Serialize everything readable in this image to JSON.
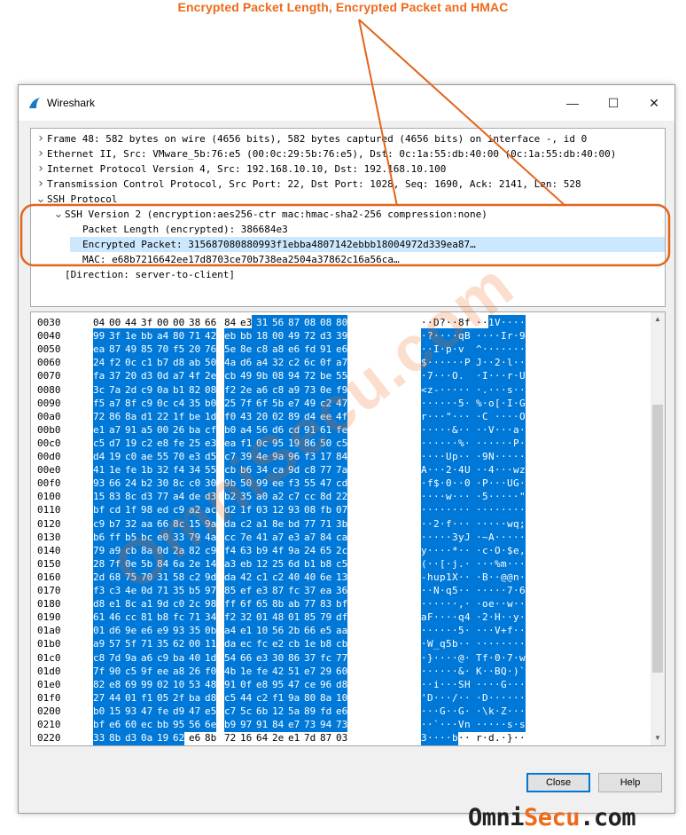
{
  "annotation": {
    "title": "Encrypted Packet Length, Encrypted Packet and HMAC"
  },
  "window": {
    "title": "Wireshark",
    "minimize_glyph": "—",
    "maximize_glyph": "☐",
    "close_glyph": "✕"
  },
  "tree": [
    {
      "text": "Frame 48: 582 bytes on wire (4656 bits), 582 bytes captured (4656 bits) on interface -, id 0",
      "expander": ">"
    },
    {
      "text": "Ethernet II, Src: VMware_5b:76:e5 (00:0c:29:5b:76:e5), Dst: 0c:1a:55:db:40:00 (0c:1a:55:db:40:00)",
      "expander": ">"
    },
    {
      "text": "Internet Protocol Version 4, Src: 192.168.10.10, Dst: 192.168.10.100",
      "expander": ">"
    },
    {
      "text": "Transmission Control Protocol, Src Port: 22, Dst Port: 1028, Seq: 1690, Ack: 2141, Len: 528",
      "expander": ">"
    },
    {
      "text": "SSH Protocol",
      "expander": "v"
    },
    {
      "text": "SSH Version 2 (encryption:aes256-ctr mac:hmac-sha2-256 compression:none)",
      "expander": "v"
    },
    {
      "text": "Packet Length (encrypted): 386684e3",
      "expander": ""
    },
    {
      "text": "Encrypted Packet: 315687080880993f1ebba4807142ebbb18004972d339ea87…",
      "expander": ""
    },
    {
      "text": "MAC: e68b7216642ee17d8703ce70b738ea2504a37862c16a56ca…",
      "expander": ""
    },
    {
      "text": "[Direction: server-to-client]",
      "expander": ""
    }
  ],
  "hex_rows": [
    {
      "off": "0030",
      "hex": "04 00 44 3f 00 00 38 66  84 e3 31 56 87 08 08 80",
      "ascii": "··D?··8f ··1V····"
    },
    {
      "off": "0040",
      "hex": "99 3f 1e bb a4 80 71 42  eb bb 18 00 49 72 d3 39",
      "ascii": "·?····qB ····Ir·9"
    },
    {
      "off": "0050",
      "hex": "ea 87 49 85 70 f5 20 76  5e 8e c8 a8 e6 fd 91 e6",
      "ascii": "··I·p· v ^·······"
    },
    {
      "off": "0060",
      "hex": "24 f2 0c c1 b7 d8 ab 50  4a d6 a4 32 c2 6c 0f a7",
      "ascii": "$······P J··2·l··"
    },
    {
      "off": "0070",
      "hex": "fa 37 20 d3 0d a7 4f 2e  cb 49 9b 08 94 72 be 55",
      "ascii": "·7 ···O. ·I···r·U"
    },
    {
      "off": "0080",
      "hex": "3c 7a 2d c9 0a b1 82 08  f2 2e a6 c8 a9 73 0e f9",
      "ascii": "<z-····· ·.···s··"
    },
    {
      "off": "0090",
      "hex": "f5 a7 8f c9 0c c4 35 b0  25 7f 6f 5b e7 49 c2 47",
      "ascii": "······5· %·o[·I·G"
    },
    {
      "off": "00a0",
      "hex": "72 86 8a d1 22 1f be 1d  f0 43 20 02 89 d4 ee 4f",
      "ascii": "r···\"··· ·C ····O"
    },
    {
      "off": "00b0",
      "hex": "e1 a7 91 a5 00 26 ba cf  b0 a4 56 d6 cd 91 61 fe",
      "ascii": "·····&·· ··V···a·"
    },
    {
      "off": "00c0",
      "hex": "c5 d7 19 c2 e8 fe 25 e3  ea f1 0c 95 19 86 50 c5",
      "ascii": "······%· ······P·"
    },
    {
      "off": "00d0",
      "hex": "d4 19 c0 ae 55 70 e3 d5  c7 39 4e 9a 96 f3 17 84",
      "ascii": "····Up·· ·9N·····"
    },
    {
      "off": "00e0",
      "hex": "41 1e fe 1b 32 f4 34 55  cb b6 34 ca 9d c8 77 7a",
      "ascii": "A···2·4U ··4···wz"
    },
    {
      "off": "00f0",
      "hex": "93 66 24 b2 30 8c c0 30  9b 50 99 ee f3 55 47 cd",
      "ascii": "·f$·0··0 ·P···UG·"
    },
    {
      "off": "0100",
      "hex": "15 83 8c d3 77 a4 de d3  b2 35 a0 a2 c7 cc 8d 22",
      "ascii": "····w··· ·5·····\""
    },
    {
      "off": "0110",
      "hex": "bf cd 1f 98 ed c9 a2 ac  d2 1f 03 12 93 08 fb 07",
      "ascii": "········ ········"
    },
    {
      "off": "0120",
      "hex": "c9 b7 32 aa 66 8c 15 9a  da c2 a1 8e bd 77 71 3b",
      "ascii": "··2·f··· ·····wq;"
    },
    {
      "off": "0130",
      "hex": "b6 ff b5 bc e0 33 79 4a  cc 7e 41 a7 e3 a7 84 ca",
      "ascii": "·····3yJ ·~A·····"
    },
    {
      "off": "0140",
      "hex": "79 a9 cb 8a 0d 2a 82 c9  f4 63 b9 4f 9a 24 65 2c",
      "ascii": "y····*·· ·c·O·$e,"
    },
    {
      "off": "0150",
      "hex": "28 7f 0e 5b 84 6a 2e 14  a3 eb 12 25 6d b1 b8 c5",
      "ascii": "(··[·j.· ···%m···"
    },
    {
      "off": "0160",
      "hex": "2d 68 75 70 31 58 c2 9d  da 42 c1 c2 40 40 6e 13",
      "ascii": "-hup1X·· ·B··@@n·"
    },
    {
      "off": "0170",
      "hex": "f3 c3 4e 0d 71 35 b5 97  85 ef e3 87 fc 37 ea 36",
      "ascii": "··N·q5·· ·····7·6"
    },
    {
      "off": "0180",
      "hex": "d8 e1 8c a1 9d c0 2c 98  ff 6f 65 8b ab 77 83 bf",
      "ascii": "······,· ·oe··w··"
    },
    {
      "off": "0190",
      "hex": "61 46 cc 81 b8 fc 71 34  f2 32 01 48 01 85 79 df",
      "ascii": "aF····q4 ·2·H··y·"
    },
    {
      "off": "01a0",
      "hex": "01 d6 9e e6 e9 93 35 0b  a4 e1 10 56 2b 66 e5 aa",
      "ascii": "······5· ···V+f··"
    },
    {
      "off": "01b0",
      "hex": "a9 57 5f 71 35 62 00 11  da ec fc e2 cb 1e b8 cb",
      "ascii": "·W_q5b·· ········"
    },
    {
      "off": "01c0",
      "hex": "c8 7d 9a a6 c9 ba 40 1d  54 66 e3 30 86 37 fc 77",
      "ascii": "·}····@· Tf·0·7·w"
    },
    {
      "off": "01d0",
      "hex": "7f 90 c5 9f ee a8 26 f0  4b 1e fe 42 51 e7 29 60",
      "ascii": "······&· K··BQ·)`"
    },
    {
      "off": "01e0",
      "hex": "82 e8 69 99 02 10 53 48  91 0f e8 95 47 ce 96 d8",
      "ascii": "··i···SH ····G···"
    },
    {
      "off": "01f0",
      "hex": "27 44 01 f1 05 2f ba d8  c5 44 c2 f1 9a 80 8a 10",
      "ascii": "'D···/·· ·D······"
    },
    {
      "off": "0200",
      "hex": "b0 15 93 47 fe d9 47 e5  c7 5c 6b 12 5a 89 fd e6",
      "ascii": "···G··G· ·\\k·Z···"
    },
    {
      "off": "0210",
      "hex": "bf e6 60 ec bb 95 56 6e  b9 97 91 84 e7 73 94 73",
      "ascii": "··`···Vn ·····s·s"
    },
    {
      "off": "0220",
      "hex": "33 8b d3 0a 19 62 e6 8b  72 16 64 2e e1 7d 87 03",
      "ascii": "3····b·· r·d.·}··"
    }
  ],
  "buttons": {
    "close": "Close",
    "help": "Help"
  },
  "watermark": "OmniSecu.com",
  "brand": {
    "part1": "Omni",
    "part2": "Secu",
    "part3": ".com"
  },
  "colors": {
    "accent": "#ee6a1b",
    "selection": "#0078d7",
    "tree_selection": "#cce8ff"
  }
}
